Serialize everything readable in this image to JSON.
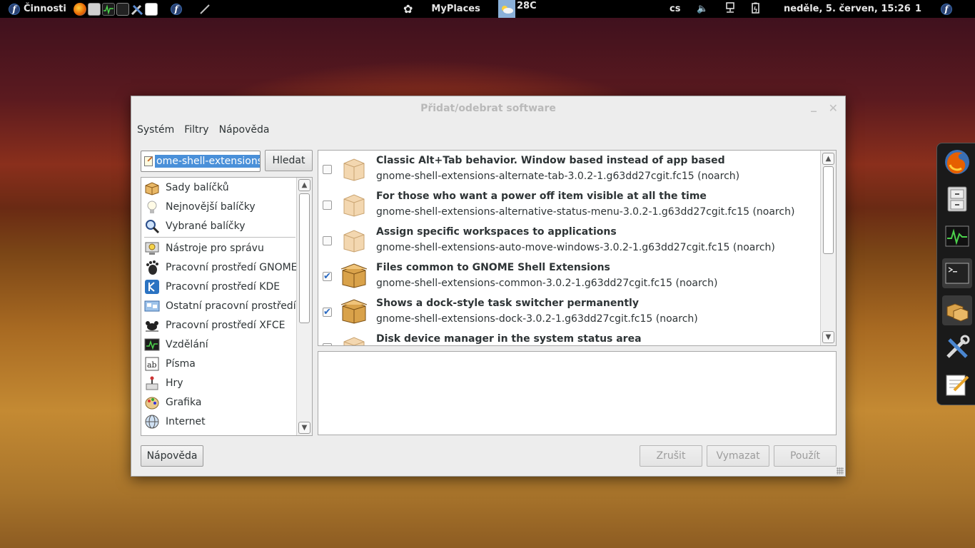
{
  "top_panel": {
    "activities": "Činnosti",
    "launchers": [
      "firefox-icon",
      "files-icon",
      "system-monitor-icon",
      "terminal-icon",
      "tools-icon",
      "editor-icon"
    ],
    "myplaces": "MyPlaces",
    "weather": "28C",
    "keyboard": "cs",
    "datetime": "neděle,  5. červen, 15:26",
    "workspace": "1"
  },
  "window": {
    "title": "Přidat/odebrat software",
    "menu": [
      "Systém",
      "Filtry",
      "Nápověda"
    ],
    "search": {
      "value": "ome-shell-extensions",
      "button": "Hledat"
    },
    "categories": [
      {
        "label": "Sady balíčků",
        "icon": "package-group-icon"
      },
      {
        "label": "Nejnovější balíčky",
        "icon": "lightbulb-icon"
      },
      {
        "label": "Vybrané balíčky",
        "icon": "magnifier-icon"
      },
      {
        "label": "Nástroje pro správu",
        "icon": "admin-tools-icon"
      },
      {
        "label": "Pracovní prostředí GNOME",
        "icon": "gnome-foot-icon"
      },
      {
        "label": "Pracovní prostředí KDE",
        "icon": "kde-icon"
      },
      {
        "label": "Ostatní pracovní prostředí",
        "icon": "desktop-icon"
      },
      {
        "label": "Pracovní prostředí XFCE",
        "icon": "xfce-mouse-icon"
      },
      {
        "label": "Vzdělání",
        "icon": "education-icon"
      },
      {
        "label": "Písma",
        "icon": "fonts-icon"
      },
      {
        "label": "Hry",
        "icon": "games-icon"
      },
      {
        "label": "Grafika",
        "icon": "graphics-icon"
      },
      {
        "label": "Internet",
        "icon": "internet-icon"
      }
    ],
    "packages": [
      {
        "title": "Classic Alt+Tab behavior. Window based instead of app based",
        "name": "gnome-shell-extensions-alternate-tab-3.0.2-1.g63dd27cgit.fc15 (noarch)",
        "checked": false
      },
      {
        "title": "For those who want a power off item visible at all the time",
        "name": "gnome-shell-extensions-alternative-status-menu-3.0.2-1.g63dd27cgit.fc15 (noarch)",
        "checked": false
      },
      {
        "title": "Assign specific workspaces to applications",
        "name": "gnome-shell-extensions-auto-move-windows-3.0.2-1.g63dd27cgit.fc15 (noarch)",
        "checked": false
      },
      {
        "title": "Files common to GNOME Shell Extensions",
        "name": "gnome-shell-extensions-common-3.0.2-1.g63dd27cgit.fc15 (noarch)",
        "checked": true
      },
      {
        "title": "Shows a dock-style task switcher permanently",
        "name": "gnome-shell-extensions-dock-3.0.2-1.g63dd27cgit.fc15 (noarch)",
        "checked": true
      },
      {
        "title": "Disk device manager in the system status area",
        "name": "",
        "checked": false
      }
    ],
    "buttons": {
      "help": "Nápověda",
      "cancel": "Zrušit",
      "clear": "Vymazat",
      "apply": "Použít"
    }
  },
  "dock": [
    "firefox-icon",
    "file-cabinet-icon",
    "system-monitor-icon",
    "terminal-icon",
    "package-manager-icon",
    "tools-icon",
    "text-editor-icon"
  ],
  "colors": {
    "selection": "#4a90d9",
    "panel_bg": "#000000",
    "window_bg": "#ededed"
  }
}
